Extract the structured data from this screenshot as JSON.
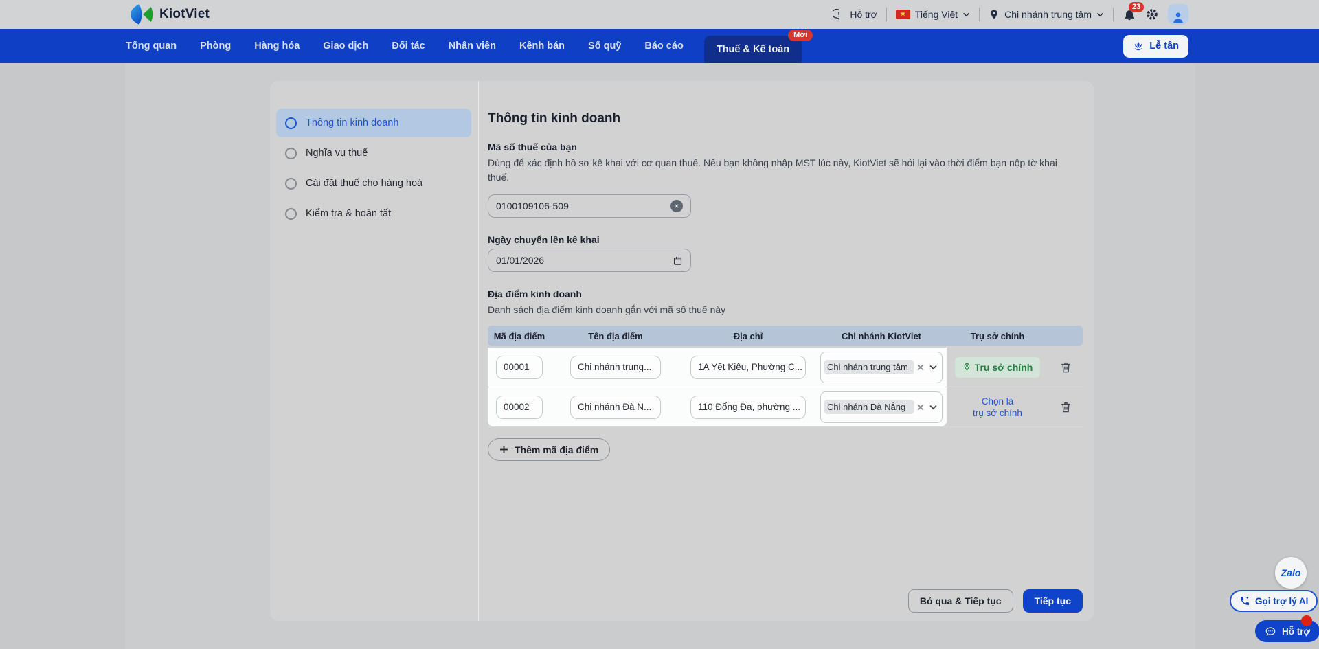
{
  "topbar": {
    "logo_text": "KiotViet",
    "help_label": "Hỗ trợ",
    "language_label": "Tiếng Việt",
    "branch_label": "Chi nhánh trung tâm",
    "notification_count": "23"
  },
  "navbar": {
    "items": [
      "Tổng quan",
      "Phòng",
      "Hàng hóa",
      "Giao dịch",
      "Đối tác",
      "Nhân viên",
      "Kênh bán",
      "Sổ quỹ",
      "Báo cáo"
    ],
    "active_item": "Thuế & Kế toán",
    "active_badge": "Mới",
    "reception_button": "Lễ tân"
  },
  "steps": {
    "items": [
      {
        "label": "Thông tin kinh doanh",
        "active": true
      },
      {
        "label": "Nghĩa vụ thuế",
        "active": false
      },
      {
        "label": "Cài đặt thuế cho hàng hoá",
        "active": false
      },
      {
        "label": "Kiểm tra & hoàn tất",
        "active": false
      }
    ]
  },
  "form": {
    "title": "Thông tin kinh doanh",
    "tax_code": {
      "label": "Mã số thuế của bạn",
      "description": "Dùng để xác định hồ sơ kê khai với cơ quan thuế. Nếu bạn không nhập MST lúc này, KiotViet sẽ hỏi lại vào thời điểm bạn nộp tờ khai thuế.",
      "value": "0100109106-509"
    },
    "declare_date": {
      "label": "Ngày chuyển lên kê khai",
      "value": "01/01/2026"
    },
    "locations": {
      "label": "Địa điểm kinh doanh",
      "description": "Danh sách địa điểm kinh doanh gắn với mã số thuế này",
      "table": {
        "headers": [
          "Mã địa điểm",
          "Tên địa điểm",
          "Địa chỉ",
          "Chi nhánh KiotViet",
          "Trụ sở chính"
        ],
        "rows": [
          {
            "code": "00001",
            "name": "Chi nhánh trung...",
            "address": "1A Yết Kiêu, Phường C...",
            "branch": "Chi nhánh trung tâm",
            "hq_badge": "Trụ sở chính"
          },
          {
            "code": "00002",
            "name": "Chi nhánh Đà N...",
            "address": "110 Đống Đa, phường ...",
            "branch": "Chi nhánh Đà Nẵng",
            "hq_link_line1": "Chọn là",
            "hq_link_line2": "trụ sở chính"
          }
        ]
      },
      "add_button": "Thêm mã địa điểm"
    },
    "footer": {
      "skip_button": "Bỏ qua & Tiếp tục",
      "continue_button": "Tiếp tục"
    }
  },
  "floating": {
    "zalo_label": "Zalo",
    "ai_button": "Gọi trợ lý AI",
    "support_button": "Hỗ trợ"
  },
  "icons": {
    "star": "★"
  },
  "colors": {
    "nav_blue": "#0e3fc4",
    "active_tab_blue": "#112e8c",
    "primary_blue": "#0f43c9",
    "badge_red": "#d6362b",
    "hq_green": "#207f3e",
    "step_active_bg": "#b3c8e3",
    "table_header_bg": "#b5c4d7"
  }
}
